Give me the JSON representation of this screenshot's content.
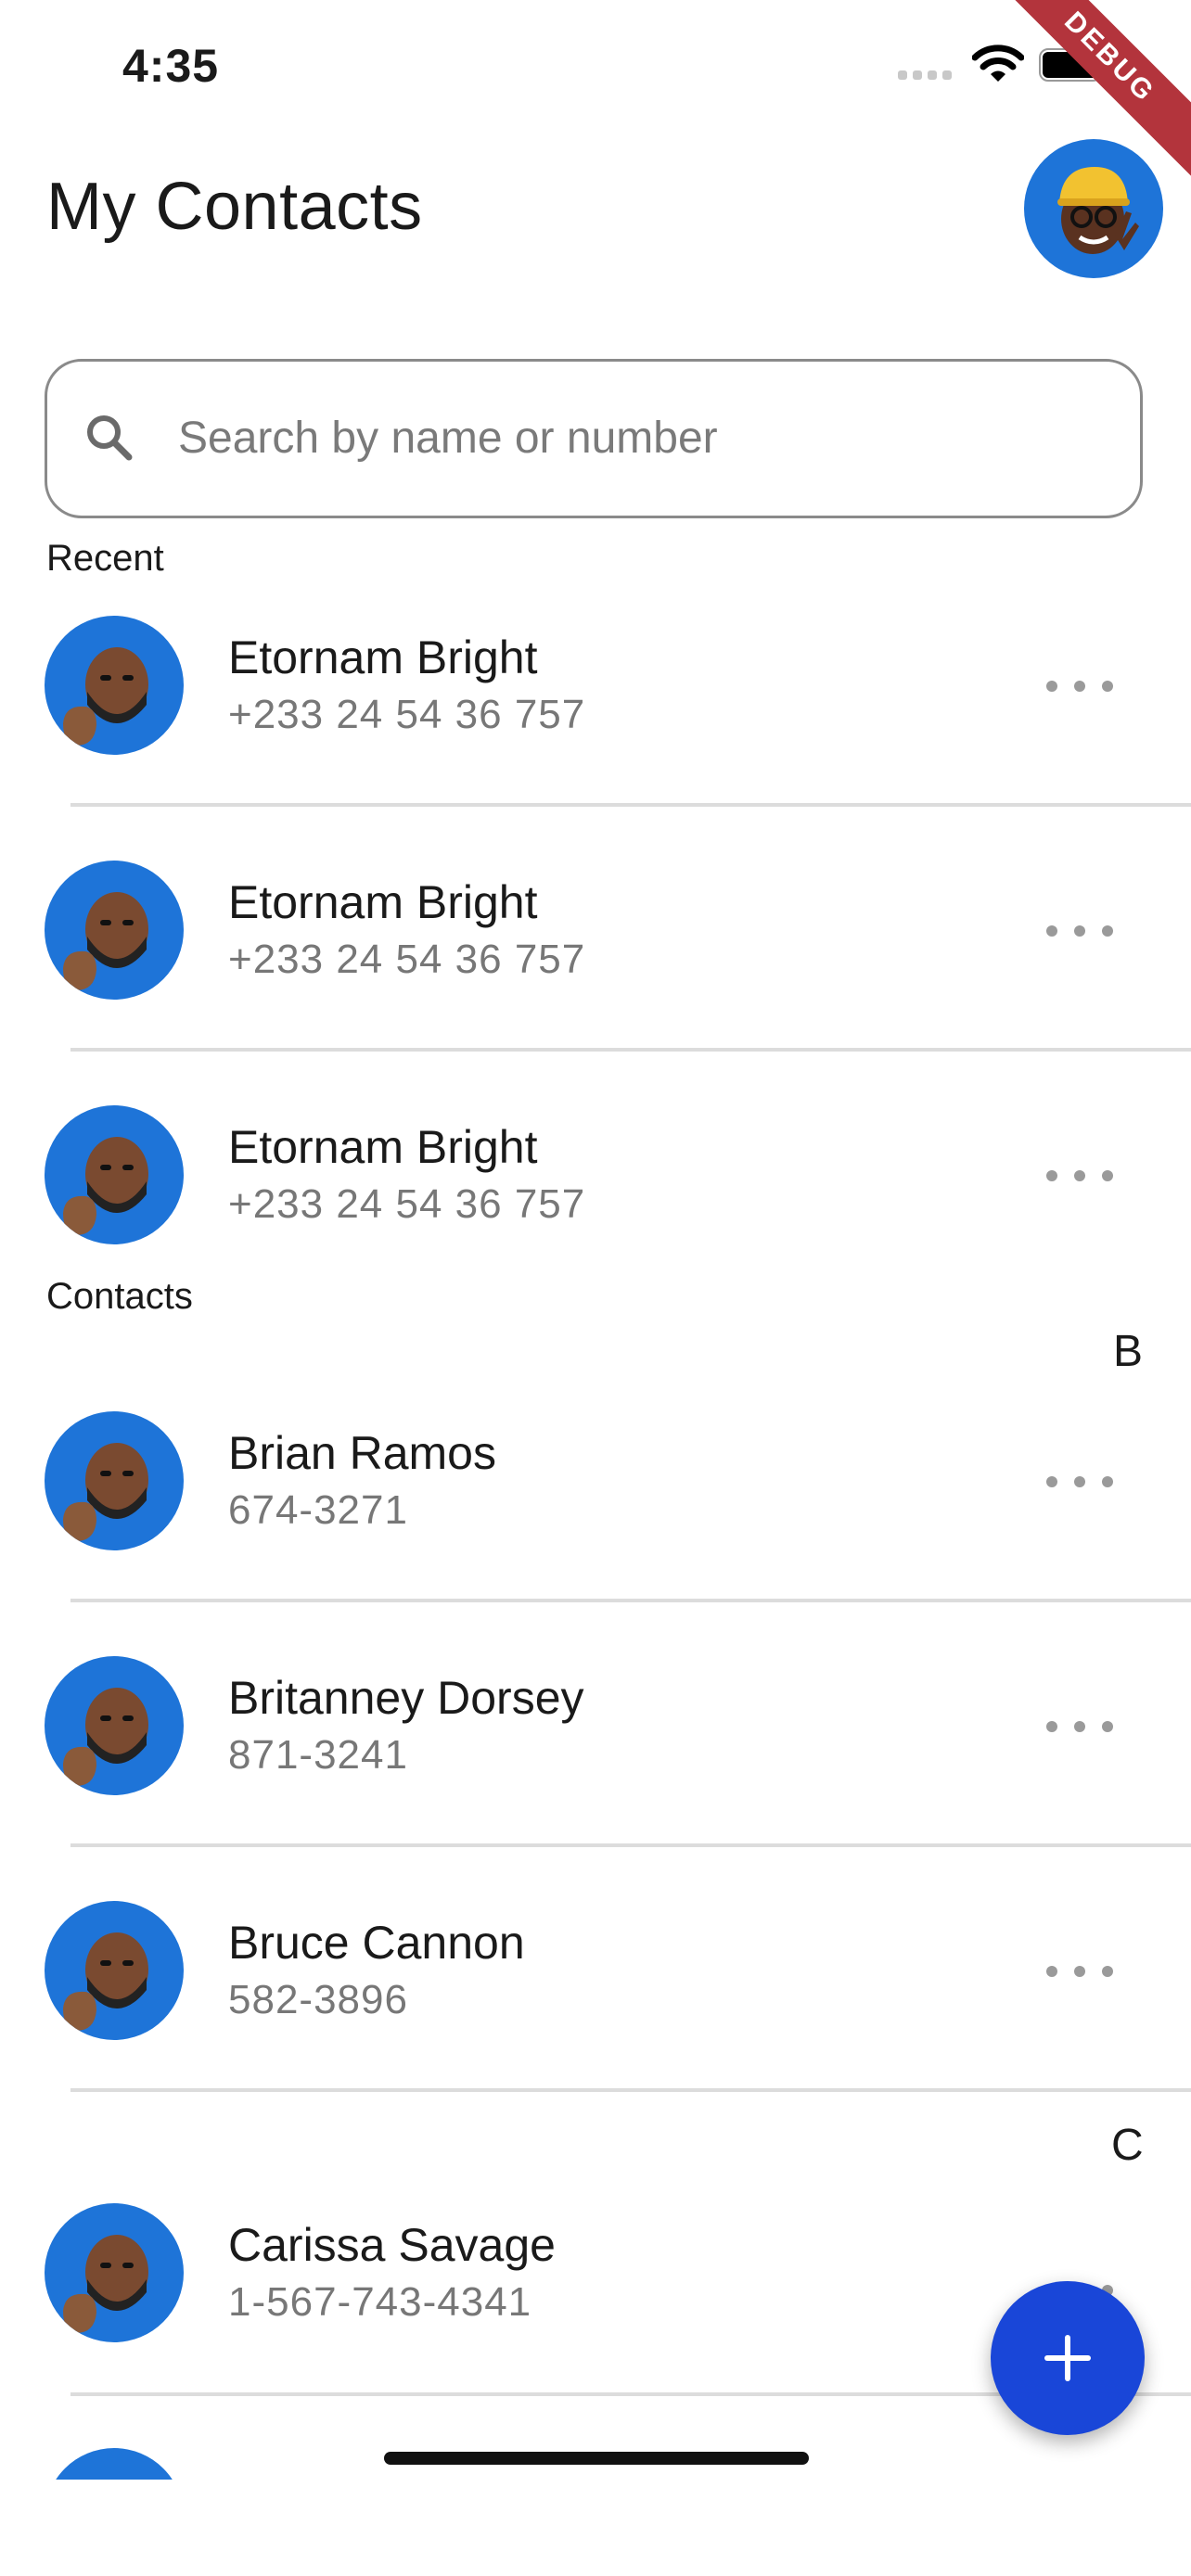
{
  "status_bar": {
    "time": "4:35"
  },
  "debug_banner": "DEBUG",
  "header": {
    "title": "My Contacts"
  },
  "search": {
    "placeholder": "Search by name or number"
  },
  "recent": {
    "label": "Recent",
    "items": [
      {
        "name": "Etornam Bright",
        "phone": "+233 24 54 36 757"
      },
      {
        "name": "Etornam Bright",
        "phone": "+233 24 54 36 757"
      },
      {
        "name": "Etornam Bright",
        "phone": "+233 24 54 36 757"
      }
    ]
  },
  "contacts": {
    "label": "Contacts",
    "groups": [
      {
        "letter": "B",
        "items": [
          {
            "name": "Brian Ramos",
            "phone": "674-3271"
          },
          {
            "name": "Britanney Dorsey",
            "phone": "871-3241"
          },
          {
            "name": "Bruce Cannon",
            "phone": "582-3896"
          }
        ]
      },
      {
        "letter": "C",
        "items": [
          {
            "name": "Carissa Savage",
            "phone": "1-567-743-4341"
          }
        ]
      }
    ]
  },
  "colors": {
    "accent": "#1e74d8",
    "fab": "#1946d8",
    "debug": "#b3343c",
    "divider": "#dcdcdc"
  },
  "icons": {
    "search": "search-icon",
    "more": "more-horizontal-icon",
    "add": "plus-icon"
  }
}
